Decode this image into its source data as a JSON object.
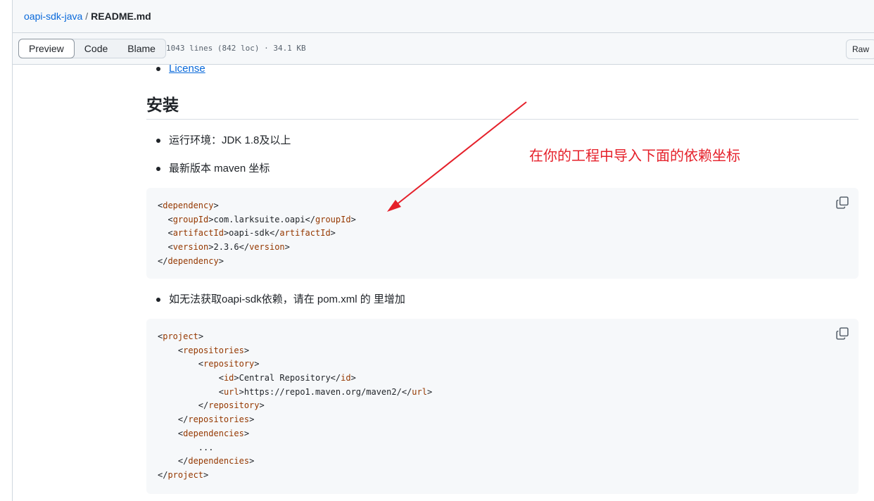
{
  "breadcrumb": {
    "repo": "oapi-sdk-java",
    "separator": "/",
    "file": "README.md"
  },
  "toolbar": {
    "tabs": [
      {
        "label": "Preview",
        "active": true
      },
      {
        "label": "Code",
        "active": false
      },
      {
        "label": "Blame",
        "active": false
      }
    ],
    "meta": "1043 lines (842 loc) · 34.1 KB",
    "raw_label": "Raw"
  },
  "readme": {
    "license_link": "License",
    "heading": "安装",
    "bullet_env": "运行环境：JDK 1.8及以上",
    "bullet_version": "最新版本 maven 坐标",
    "dependency_block": {
      "lines": [
        {
          "indent": "",
          "open": "dependency",
          "text": "",
          "close": ""
        },
        {
          "indent": "  ",
          "open": "groupId",
          "text": "com.larksuite.oapi",
          "close": "groupId"
        },
        {
          "indent": "  ",
          "open": "artifactId",
          "text": "oapi-sdk",
          "close": "artifactId"
        },
        {
          "indent": "  ",
          "open": "version",
          "text": "2.3.6",
          "close": "version"
        },
        {
          "indent": "",
          "open": "",
          "text": "",
          "close": "dependency"
        }
      ]
    },
    "bullet_fallback": "如无法获取oapi-sdk依赖，请在 pom.xml 的 里增加",
    "project_block": {
      "lines": [
        {
          "indent": "",
          "open": "project",
          "text": "",
          "close": ""
        },
        {
          "indent": "    ",
          "open": "repositories",
          "text": "",
          "close": ""
        },
        {
          "indent": "        ",
          "open": "repository",
          "text": "",
          "close": ""
        },
        {
          "indent": "            ",
          "open": "id",
          "text": "Central Repository",
          "close": "id"
        },
        {
          "indent": "            ",
          "open": "url",
          "text": "https://repo1.maven.org/maven2/",
          "close": "url"
        },
        {
          "indent": "        ",
          "open": "",
          "text": "",
          "close": "repository"
        },
        {
          "indent": "    ",
          "open": "",
          "text": "",
          "close": "repositories"
        },
        {
          "indent": "    ",
          "open": "dependencies",
          "text": "",
          "close": ""
        },
        {
          "indent": "        ",
          "open": "",
          "text": "...",
          "close": ""
        },
        {
          "indent": "    ",
          "open": "",
          "text": "",
          "close": "dependencies"
        },
        {
          "indent": "",
          "open": "",
          "text": "",
          "close": "project"
        }
      ]
    }
  },
  "annotation": {
    "text": "在你的工程中导入下面的依赖坐标",
    "color": "#e5202a"
  },
  "colors": {
    "link": "#0969da",
    "tag": "#953800",
    "code_bg": "#f6f8fa"
  }
}
